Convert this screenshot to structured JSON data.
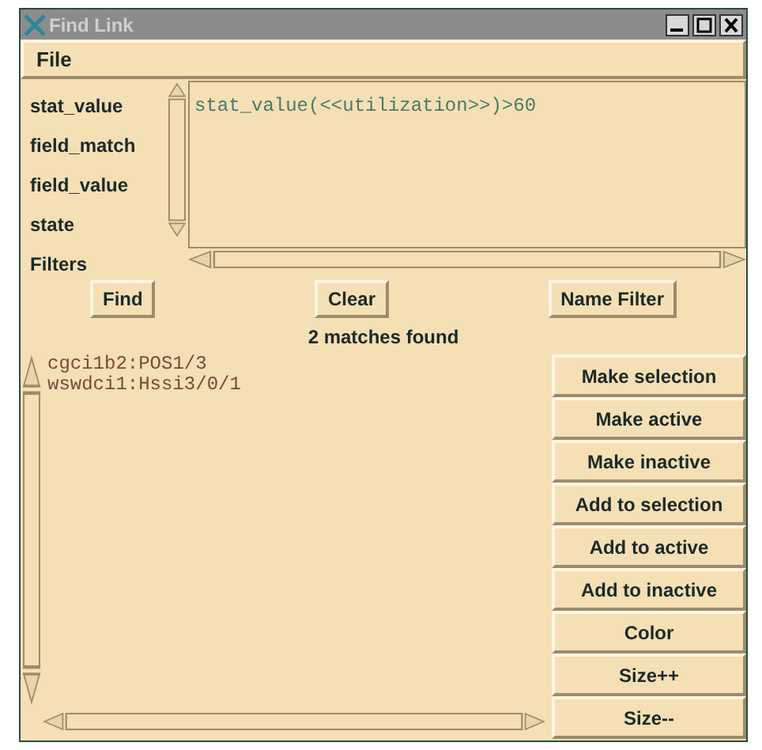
{
  "window": {
    "title": "Find Link"
  },
  "menu": [
    "File"
  ],
  "filter_list": [
    "stat_value",
    "field_match",
    "field_value",
    "state",
    "Filters"
  ],
  "query": {
    "value": "stat_value(<<utilization>>)>60"
  },
  "buttons": [
    "Find",
    "Clear",
    "Name Filter"
  ],
  "status": "2 matches found",
  "results": [
    "cgci1b2:POS1/3",
    "wswdci1:Hssi3/0/1"
  ],
  "actions": [
    "Make selection",
    "Make active",
    "Make inactive",
    "Add to selection",
    "Add to active",
    "Add to inactive",
    "Color",
    "Size++",
    "Size--"
  ]
}
